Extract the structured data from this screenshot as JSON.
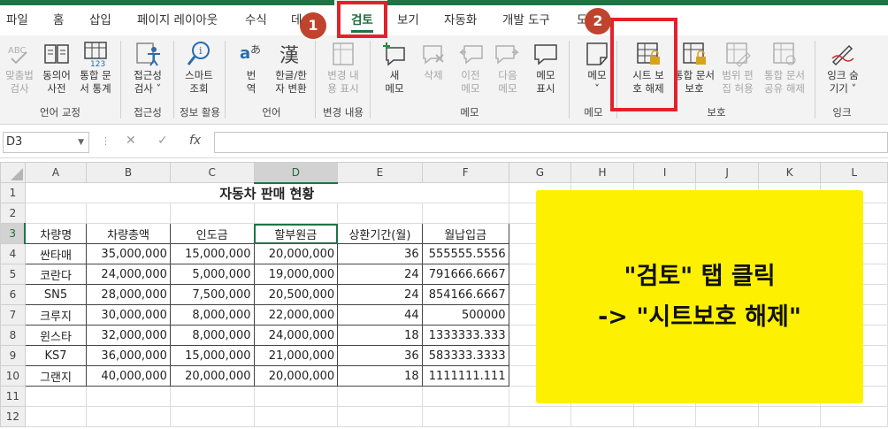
{
  "tabs": [
    {
      "label": "파일"
    },
    {
      "label": "홈"
    },
    {
      "label": "삽입"
    },
    {
      "label": "페이지 레이아웃"
    },
    {
      "label": "수식"
    },
    {
      "label": "데"
    },
    {
      "label": "검토"
    },
    {
      "label": "보기"
    },
    {
      "label": "자동화"
    },
    {
      "label": "개발 도구"
    },
    {
      "label": "도"
    }
  ],
  "active_tab": "검토",
  "ribbon": {
    "buttons": [
      {
        "line1": "맞춤법",
        "line2": "검사",
        "icon": "spellcheck-icon"
      },
      {
        "line1": "동의어",
        "line2": "사전",
        "icon": "thesaurus-icon"
      },
      {
        "line1": "통합 문",
        "line2": "서 통계",
        "icon": "workbook-statistics-icon"
      },
      {
        "line1": "접근성",
        "line2": "검사 ˅",
        "icon": "accessibility-icon"
      },
      {
        "line1": "스마트",
        "line2": "조회",
        "icon": "smart-lookup-icon"
      },
      {
        "line1": "번",
        "line2": "역",
        "icon": "translate-icon"
      },
      {
        "line1": "한글/한",
        "line2": "자 변환",
        "icon": "hanja-convert-icon"
      },
      {
        "line1": "변경 내",
        "line2": "용 표시",
        "icon": "show-changes-icon"
      },
      {
        "line1": "새",
        "line2": "메모",
        "icon": "new-comment-icon"
      },
      {
        "line1": "삭제",
        "line2": "",
        "icon": "delete-comment-icon"
      },
      {
        "line1": "이전",
        "line2": "메모",
        "icon": "previous-comment-icon"
      },
      {
        "line1": "다음",
        "line2": "메모",
        "icon": "next-comment-icon"
      },
      {
        "line1": "메모",
        "line2": "표시",
        "icon": "show-comments-icon"
      },
      {
        "line1": "메모",
        "line2": "˅",
        "icon": "notes-icon"
      },
      {
        "line1": "시트 보",
        "line2": "호 해제",
        "icon": "unprotect-sheet-icon"
      },
      {
        "line1": "통합 문서",
        "line2": "보호",
        "icon": "protect-workbook-icon"
      },
      {
        "line1": "범위 편",
        "line2": "집 허용",
        "icon": "allow-edit-ranges-icon"
      },
      {
        "line1": "통합 문서",
        "line2": "공유 해제",
        "icon": "unshare-workbook-icon"
      },
      {
        "line1": "잉크 숨",
        "line2": "기기 ˅",
        "icon": "hide-ink-icon"
      }
    ],
    "groups": [
      "언어 교정",
      "접근성",
      "정보 활용",
      "언어",
      "변경 내용",
      "메모",
      "메모",
      "보호",
      "잉크"
    ]
  },
  "annotations": {
    "badge1": "1",
    "badge2": "2",
    "colors": {
      "box": "#e4212b",
      "badge": "#c0432d"
    }
  },
  "formula_bar": {
    "name_box": "D3",
    "cancel": "✕",
    "enter": "✓",
    "fx": "fx",
    "value": ""
  },
  "columns": [
    "A",
    "B",
    "C",
    "D",
    "E",
    "F",
    "G",
    "H",
    "I",
    "J",
    "K",
    "L"
  ],
  "rows": [
    "1",
    "2",
    "3",
    "4",
    "5",
    "6",
    "7",
    "8",
    "9",
    "10",
    "11",
    "12"
  ],
  "sheet": {
    "title": "자동차 판매 현황",
    "headers": [
      "차량명",
      "차량총액",
      "인도금",
      "할부원금",
      "상환기간(월)",
      "월납입금"
    ],
    "data": [
      [
        "싼타매",
        "35,000,000",
        "15,000,000",
        "20,000,000",
        "36",
        "555555.5556"
      ],
      [
        "코란다",
        "24,000,000",
        "5,000,000",
        "19,000,000",
        "24",
        "791666.6667"
      ],
      [
        "SN5",
        "28,000,000",
        "7,500,000",
        "20,500,000",
        "24",
        "854166.6667"
      ],
      [
        "크루지",
        "30,000,000",
        "8,000,000",
        "22,000,000",
        "44",
        "500000"
      ],
      [
        "윈스타",
        "32,000,000",
        "8,000,000",
        "24,000,000",
        "18",
        "1333333.333"
      ],
      [
        "KS7",
        "36,000,000",
        "15,000,000",
        "21,000,000",
        "36",
        "583333.3333"
      ],
      [
        "그랜지",
        "40,000,000",
        "20,000,000",
        "20,000,000",
        "18",
        "1111111.111"
      ]
    ]
  },
  "note": {
    "line1": "\"검토\" 탭 클릭",
    "line2": "-> \"시트보호 해제\"",
    "color": "#fdf000"
  }
}
